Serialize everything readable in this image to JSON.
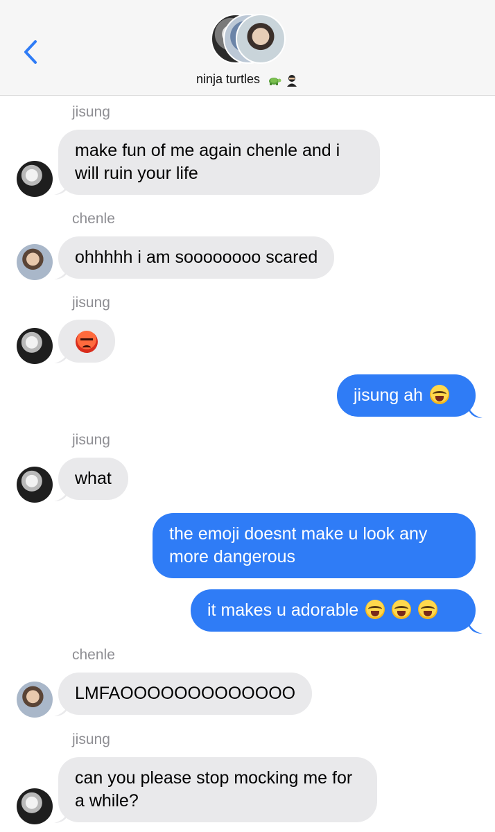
{
  "header": {
    "group_name": "ninja turtles",
    "title_emojis": [
      "turtle-icon",
      "ninja-icon"
    ],
    "back_icon": "chevron-left-icon",
    "accent": "#2f7cf6"
  },
  "colors": {
    "incoming_bubble": "#e9e9eb",
    "outgoing_bubble": "#2f7cf6",
    "sender_name": "#8e8e93"
  },
  "messages": [
    {
      "sender": "jisung",
      "direction": "in",
      "text": "make fun of me again chenle and i will ruin your life"
    },
    {
      "sender": "chenle",
      "direction": "in",
      "text": "ohhhhh i am soooooooo scared"
    },
    {
      "sender": "jisung",
      "direction": "in",
      "text": "",
      "emoji": "angry-face-icon"
    },
    {
      "sender": "",
      "direction": "out",
      "text": "jisung ah",
      "emoji": "sob-icon"
    },
    {
      "sender": "jisung",
      "direction": "in",
      "text": "what"
    },
    {
      "sender": "",
      "direction": "out",
      "text": "the emoji doesnt make u look any more dangerous"
    },
    {
      "sender": "",
      "direction": "out",
      "text": "it makes u adorable",
      "emoji": "sob-icon x3"
    },
    {
      "sender": "chenle",
      "direction": "in",
      "text": "LMFAOOOOOOOOOOOOO"
    },
    {
      "sender": "jisung",
      "direction": "in",
      "text": "can you please stop mocking me for a while?"
    }
  ]
}
